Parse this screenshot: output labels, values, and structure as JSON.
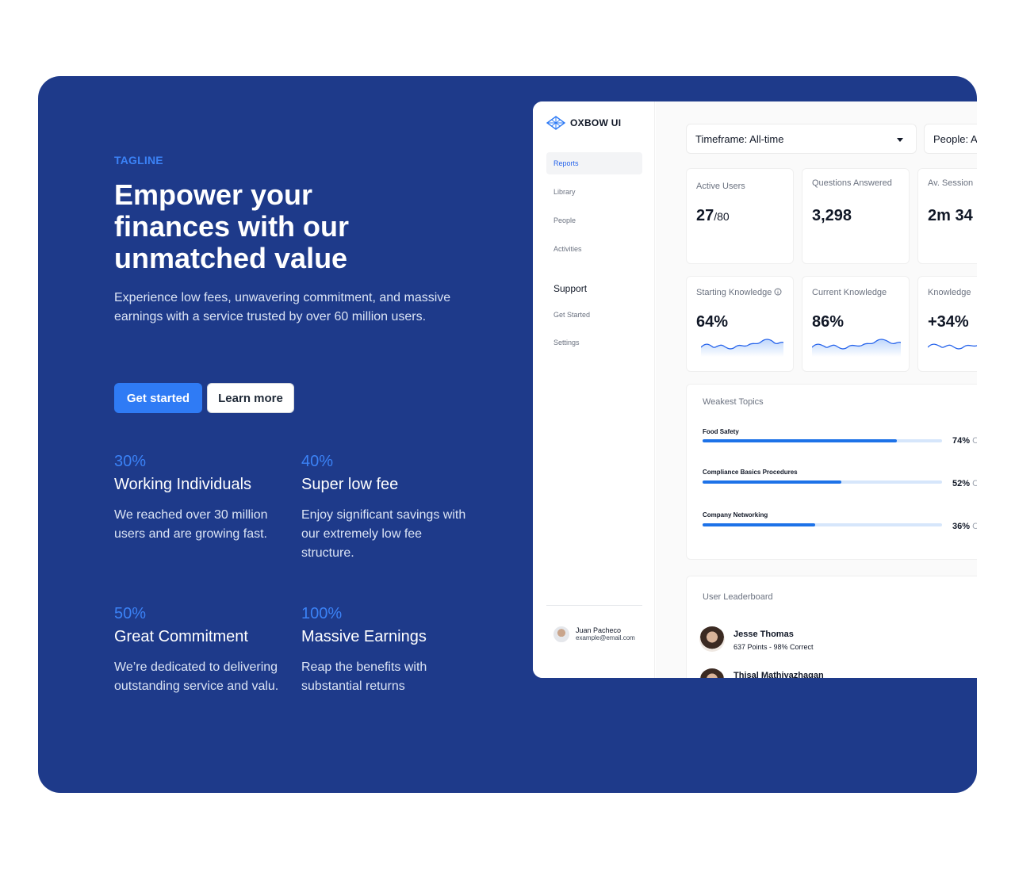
{
  "hero": {
    "tagline": "TAGLINE",
    "headline": "Empower your finances with our unmatched value",
    "subtext": "Experience low fees, unwavering commitment, and massive earnings with a service trusted by over 60 million users.",
    "primary_button": "Get started",
    "secondary_button": "Learn more",
    "stats": [
      {
        "percent": "30%",
        "title": "Working Individuals",
        "description": "We reached over 30 million users and are growing fast."
      },
      {
        "percent": "40%",
        "title": "Super low fee",
        "description": "Enjoy significant savings with our extremely low fee structure."
      },
      {
        "percent": "50%",
        "title": "Great Commitment",
        "description": "We’re dedicated to delivering outstanding service and valu."
      },
      {
        "percent": "100%",
        "title": "Massive Earnings",
        "description": "Reap the benefits with substantial returns"
      }
    ],
    "colors": {
      "background": "#1e3a8a",
      "accent": "#3b82f6",
      "button": "#2f7bf5"
    }
  },
  "dashboard": {
    "brand": "OXBOW UI",
    "nav": [
      "Reports",
      "Library",
      "People",
      "Activities"
    ],
    "active_nav": "Reports",
    "support_heading": "Support",
    "support_items": [
      "Get Started",
      "Settings"
    ],
    "user": {
      "name": "Juan Pacheco",
      "email": "example@email.com"
    },
    "filters": {
      "timeframe": "Timeframe: All-time",
      "people": "People: A"
    },
    "metrics": [
      {
        "label": "Active Users",
        "value": "27",
        "suffix": "/80"
      },
      {
        "label": "Questions Answered",
        "value": "3,298"
      },
      {
        "label": "Av. Session",
        "value": "2m 34"
      }
    ],
    "knowledge": [
      {
        "label": "Starting Knowledge",
        "value": "64%"
      },
      {
        "label": "Current Knowledge",
        "value": "86%"
      },
      {
        "label": "Knowledge",
        "value": "+34%"
      }
    ],
    "weakest_topics": {
      "title": "Weakest Topics",
      "items": [
        {
          "name": "Food Safety",
          "percent_label": "74%",
          "fraction": 0.81,
          "trail": "C"
        },
        {
          "name": "Compliance Basics Procedures",
          "percent_label": "52%",
          "fraction": 0.58,
          "trail": "C"
        },
        {
          "name": "Company Networking",
          "percent_label": "36%",
          "fraction": 0.47,
          "trail": "C"
        }
      ]
    },
    "leaderboard": {
      "title": "User Leaderboard",
      "entries": [
        {
          "name": "Jesse Thomas",
          "detail": "637 Points - 98% Correct"
        },
        {
          "name": "Thisal Mathiyazhagan",
          "detail": ""
        }
      ]
    }
  }
}
